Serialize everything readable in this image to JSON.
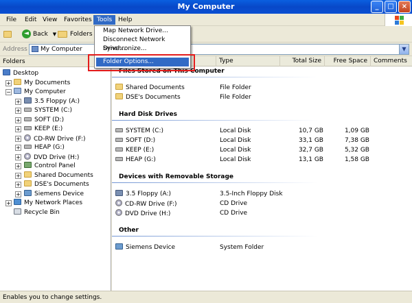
{
  "window": {
    "title": "My Computer"
  },
  "menu": {
    "items": [
      {
        "label": "File"
      },
      {
        "label": "Edit"
      },
      {
        "label": "View"
      },
      {
        "label": "Favorites"
      },
      {
        "label": "Tools"
      },
      {
        "label": "Help"
      }
    ]
  },
  "tools_menu": {
    "items": [
      {
        "label": "Map Network Drive..."
      },
      {
        "label": "Disconnect Network Drive..."
      },
      {
        "label": "Synchronize..."
      },
      {
        "label": "Folder Options..."
      }
    ]
  },
  "toolbar": {
    "back_label": "Back",
    "folders_label": "Folders"
  },
  "address": {
    "label": "Address",
    "value": "My Computer"
  },
  "folders": {
    "header": "Folders",
    "tree": [
      {
        "label": "Desktop"
      },
      {
        "label": "My Documents"
      },
      {
        "label": "My Computer"
      },
      {
        "label": "3.5 Floppy (A:)"
      },
      {
        "label": "SYSTEM (C:)"
      },
      {
        "label": "SOFT (D:)"
      },
      {
        "label": "KEEP (E:)"
      },
      {
        "label": "CD-RW Drive (F:)"
      },
      {
        "label": "HEAP (G:)"
      },
      {
        "label": "DVD Drive (H:)"
      },
      {
        "label": "Control Panel"
      },
      {
        "label": "Shared Documents"
      },
      {
        "label": "DSE's Documents"
      },
      {
        "label": "Siemens Device"
      },
      {
        "label": "My Network Places"
      },
      {
        "label": "Recycle Bin"
      }
    ]
  },
  "columns": {
    "name": "Name",
    "type": "Type",
    "total": "Total Size",
    "free": "Free Space",
    "comments": "Comments"
  },
  "groups": {
    "files": {
      "title": "Files Stored on This Computer",
      "rows": [
        {
          "name": "Shared Documents",
          "type": "File Folder"
        },
        {
          "name": "DSE's Documents",
          "type": "File Folder"
        }
      ]
    },
    "hdd": {
      "title": "Hard Disk Drives",
      "rows": [
        {
          "name": "SYSTEM (C:)",
          "type": "Local Disk",
          "total": "10,7 GB",
          "free": "1,09 GB"
        },
        {
          "name": "SOFT (D:)",
          "type": "Local Disk",
          "total": "33,1 GB",
          "free": "7,38 GB"
        },
        {
          "name": "KEEP (E:)",
          "type": "Local Disk",
          "total": "32,7 GB",
          "free": "5,32 GB"
        },
        {
          "name": "HEAP (G:)",
          "type": "Local Disk",
          "total": "13,1 GB",
          "free": "1,58 GB"
        }
      ]
    },
    "removable": {
      "title": "Devices with Removable Storage",
      "rows": [
        {
          "name": "3.5 Floppy (A:)",
          "type": "3.5-Inch Floppy Disk"
        },
        {
          "name": "CD-RW Drive (F:)",
          "type": "CD Drive"
        },
        {
          "name": "DVD Drive (H:)",
          "type": "CD Drive"
        }
      ]
    },
    "other": {
      "title": "Other",
      "rows": [
        {
          "name": "Siemens Device",
          "type": "System Folder"
        }
      ]
    }
  },
  "status": {
    "text": "Enables you to change settings."
  },
  "colors": {
    "highlight": "#316ac5",
    "annotation": "#e41b1b",
    "titlebar": "#0a5fe0"
  }
}
